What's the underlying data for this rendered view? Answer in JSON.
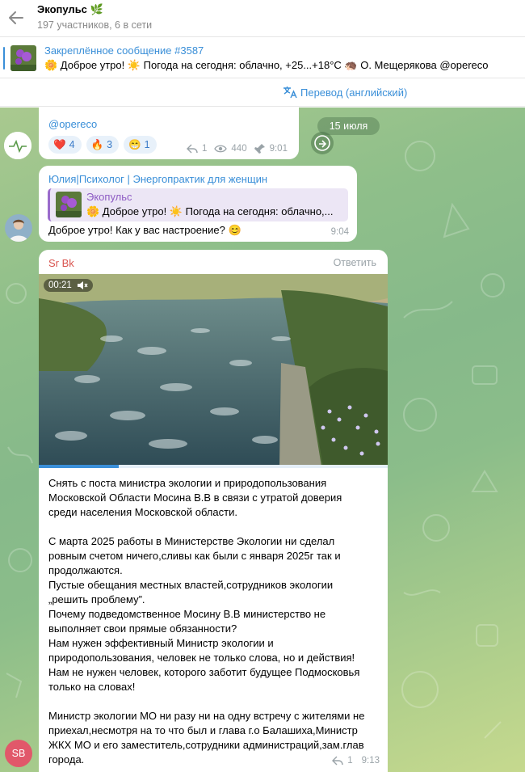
{
  "header": {
    "title": "Экопульс 🌿",
    "subtitle": "197 участников, 6 в сети"
  },
  "pinned": {
    "title": "Закреплённое сообщение #3587",
    "text": "🌼 Доброе утро!  ☀️  Погода на сегодня: облачно, +25...+18°C  🦔 О. Мещерякова  @opereco"
  },
  "translate": {
    "label": "Перевод (английский)"
  },
  "date_pill": "15 июля",
  "messages": [
    {
      "link": "@opereco",
      "reactions": [
        {
          "emoji": "❤️",
          "count": "4"
        },
        {
          "emoji": "🔥",
          "count": "3"
        },
        {
          "emoji": "😁",
          "count": "1"
        }
      ],
      "replies": "1",
      "views": "440",
      "time": "9:01"
    },
    {
      "sender": "Юлия|Психолог | Энергопрактик для женщин",
      "quote_name": "Экопульс",
      "quote_text": "🌼 Доброе утро!  ☀️  Погода на сегодня: облачно,...",
      "text": "Доброе утро! Как у вас настроение? 😊",
      "time": "9:04"
    },
    {
      "sender": "Sr Bk",
      "reply_label": "Ответить",
      "video_time": "00:21",
      "video_progress": 0.23,
      "paragraphs": [
        "Снять с поста министра экологии и природопользования",
        "Московской Области Мосина В.В в связи с утратой доверия",
        "среди населения Московской области.",
        "",
        "С марта 2025 работы в Министерстве Экологии ни сделал",
        "ровным счетом ничего,сливы как были с января 2025г так и",
        "продолжаются.",
        "Пустые обещания местных властей,сотрудников экологии",
        "„решить проблему”.",
        "Почему подведомственное Мосину В.В министерство не",
        "выполняет свои прямые обязанности?",
        "Нам нужен эффективный Министр экологии и",
        "природопользования, человек не только слова, но и действия!",
        "Нам не нужен человек, которого заботит будущее Подмосковья",
        "только на словах!",
        "",
        "Министр экологии МО ни разу ни на одну встречу с жителями не",
        "приехал,несмотря на то что был и глава г.о Балашиха,Министр",
        "ЖКХ МО и его заместитель,сотрудники администраций,зам.глав",
        "города."
      ],
      "replies": "1",
      "time": "9:13",
      "avatar_initials": "SB"
    }
  ],
  "colors": {
    "accent": "#3a8fd8",
    "quote_accent": "#9a6bcc",
    "sender_red": "#d9544f",
    "avatar_sb": "#e1586a"
  }
}
